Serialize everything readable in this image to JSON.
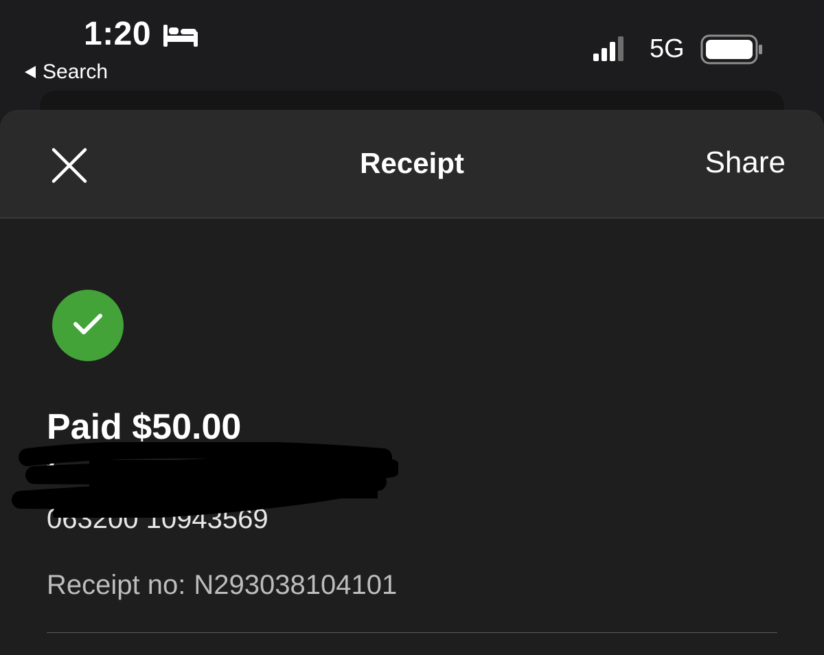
{
  "status_bar": {
    "time": "1:20",
    "back_label": "Search",
    "network": "5G",
    "icons": [
      "bed-icon",
      "signal-icon",
      "battery-icon"
    ]
  },
  "sheet": {
    "title": "Receipt",
    "share_label": "Share",
    "close_icon": "close-icon"
  },
  "payment": {
    "status_icon": "check-icon",
    "status_color": "#43a339",
    "paid_text": "Paid $50.00",
    "to_text": "to",
    "account_text": "063200 10943569",
    "receipt_label": "Receipt no:",
    "receipt_number": "N293038104101"
  }
}
